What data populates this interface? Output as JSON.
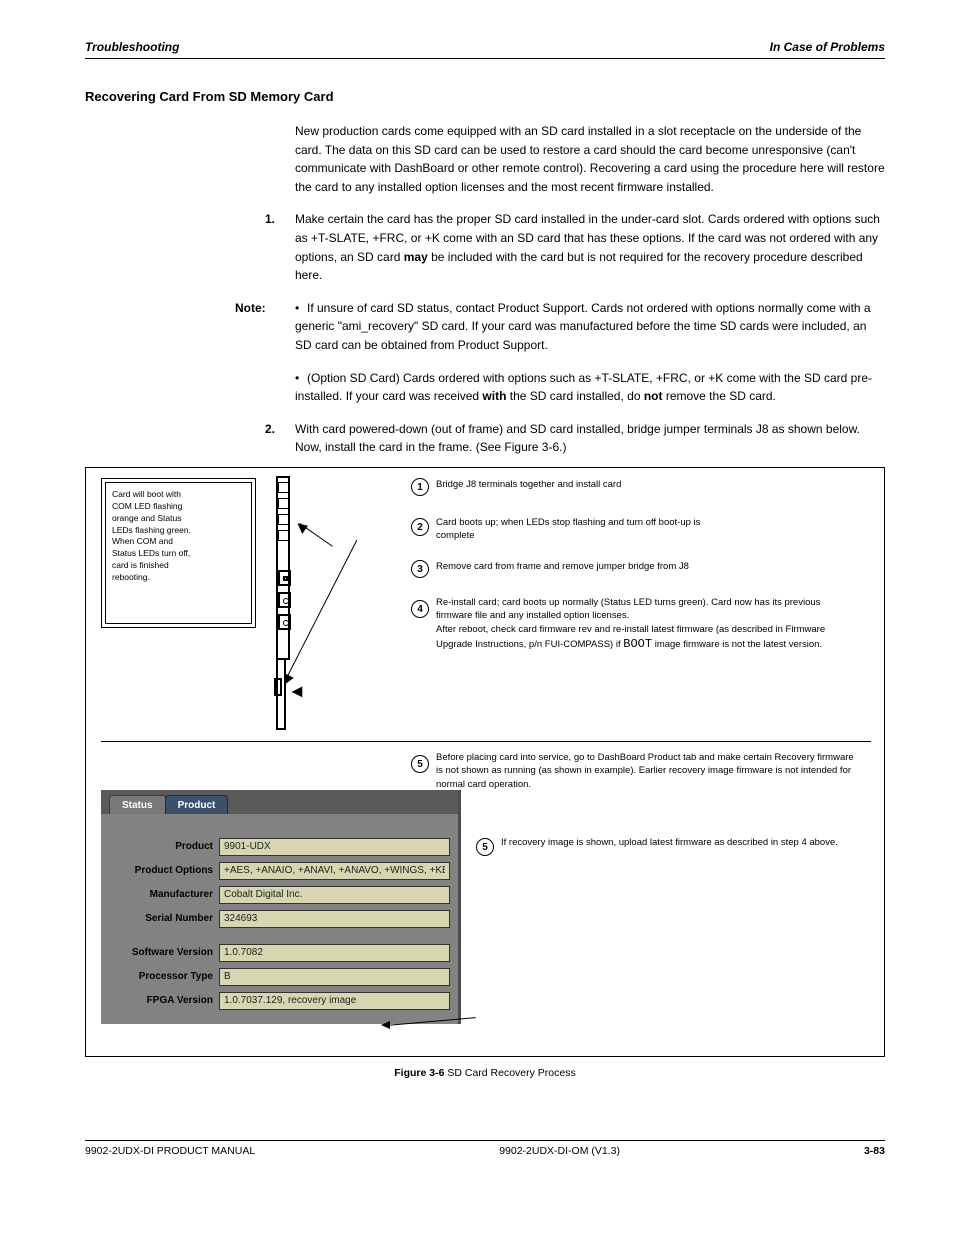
{
  "header": {
    "left_italic": "Troubleshooting",
    "right_bold": "In Case of Problems"
  },
  "section_heading": "Recovering Card From SD Memory Card",
  "paragraphs": {
    "p1": "New production cards come equipped with an SD card installed in a slot receptacle on the underside of the card. The data on this SD card can be used to restore a card should the card become unresponsive (can't communicate with DashBoard or other remote control). Recovering a card using the procedure here will restore the card to any installed option licenses and the most recent firmware installed.",
    "p2": "Make certain the card has the proper SD card installed in the under-card slot. Cards ordered with options such as +T-SLATE, +FRC, or +K come with an SD card that has these options. If the card was not ordered with any options, an SD card ",
    "p2b": "may",
    "p2c": " be included with the card but is not required for the recovery procedure described here.",
    "note1": "If unsure of card SD status, contact Product Support. Cards not ordered with options normally come with a generic \"ami_recovery\" SD card. If your card was manufactured before the time SD cards were included, an SD card can be obtained from Product Support.",
    "note2": "(Option SD Card) Cards ordered with options such as +T-SLATE, +FRC, or +K come with the SD card pre-installed. If your card was received ",
    "note2b": "with",
    "note2c": " the SD card installed, do ",
    "note2d": "not",
    "note2e": " remove the SD card.",
    "p4": "With card powered-down (out of frame) and SD card installed, bridge jumper terminals J8 as shown below. Now, install the card in the frame. (See Figure 3-6.)"
  },
  "figure": {
    "card_box_lines": [
      "Card will boot with",
      "COM LED flashing",
      "orange and Status",
      "LEDs flashing green.",
      "When COM and",
      "Status LEDs turn off,",
      "card is finished",
      "rebooting."
    ],
    "steps": {
      "s1": "Bridge J8 terminals together and install card",
      "s2": "Card boots up; when LEDs stop flashing and turn off boot-up is complete",
      "s3": "Remove card from frame and remove jumper bridge from J8",
      "s4_a": "Re-install card; card boots up normally (Status LED turns green). Card now has its previous firmware file and any installed option licenses.",
      "s4_b": "After reboot, check card firmware rev and re-install latest firmware (as described in Firmware Upgrade Instructions, p/n FUI-COMPASS) if ",
      "s4_boot": "BOOT",
      "s4_c": " image firmware is not the latest version.",
      "s5": "Before placing card into service, go to DashBoard Product tab and make certain Recovery firmware is not shown as running (as shown in example). Earlier recovery image firmware is not intended for normal card operation.",
      "s5b": "If recovery image is shown, upload latest firmware as described in step 4 above."
    },
    "panel": {
      "tab_status": "Status",
      "tab_product": "Product",
      "product_label": "Product",
      "product_value": "9901-UDX",
      "options_label": "Product Options",
      "options_value": "+AES, +ANAIO, +ANAVI, +ANAVO, +WINGS, +KEYE",
      "manufacturer_label": "Manufacturer",
      "manufacturer_value": "Cobalt Digital Inc.",
      "serial_label": "Serial Number",
      "serial_value": "324693",
      "swver_label": "Software Version",
      "swver_value": "1.0.7082",
      "proc_label": "Processor Type",
      "proc_value": "B",
      "fpga_label": "FPGA Version",
      "fpga_value": "1.0.7037.129, recovery image"
    },
    "caption_prefix": "Figure 3-6  ",
    "caption": "SD Card Recovery Process"
  },
  "footer": {
    "left": "9902-2UDX-DI PRODUCT MANUAL",
    "center": "9902-2UDX-DI-OM (V1.3)",
    "right": "3-83"
  },
  "list_markers": {
    "num1": "1.",
    "num2": "2.",
    "bullet": "•"
  }
}
